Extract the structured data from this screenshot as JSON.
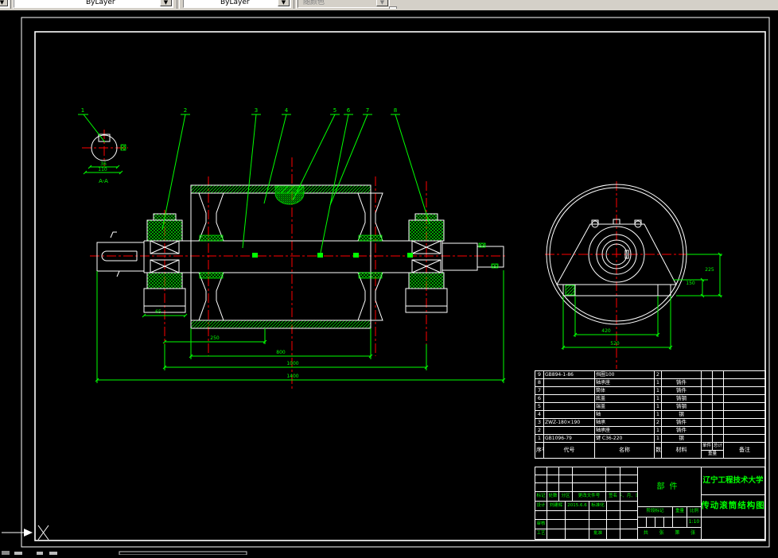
{
  "toolbar": {
    "linetype_value": "ByLayer",
    "lineweight_value": "ByLayer",
    "plotstyle_value": "随颜色"
  },
  "canvas": {
    "ucs_label": "X"
  },
  "detail_view": {
    "balloon": "1",
    "label": "A-A",
    "dim_width": "36",
    "dim_outer": "110"
  },
  "main_view": {
    "balloons": [
      "2",
      "3",
      "4",
      "5",
      "6",
      "7",
      "8"
    ],
    "dim_bearing": "65",
    "dim_hub": "250",
    "dim_shell": "800",
    "dim_span": "1000",
    "dim_total": "1400"
  },
  "side_view": {
    "dim_height": "225",
    "dim_base_height": "150",
    "dim_bolt_span": "420",
    "dim_base": "520"
  },
  "bom": {
    "headers": {
      "no": "序号",
      "code": "代号",
      "name": "名称",
      "qty": "数量",
      "material": "材料",
      "unit": "单件",
      "total": "总计",
      "weight": "重量",
      "remark": "备注"
    },
    "rows": [
      {
        "no": "9",
        "code": "GB894-1-86",
        "name": "挡圈100",
        "qty": "2",
        "material": ""
      },
      {
        "no": "8",
        "code": "",
        "name": "轴承座",
        "qty": "1",
        "material": "铸件"
      },
      {
        "no": "7",
        "code": "",
        "name": "筒体",
        "qty": "1",
        "material": "铸件"
      },
      {
        "no": "6",
        "code": "",
        "name": "底盖",
        "qty": "1",
        "material": "铸钢"
      },
      {
        "no": "5",
        "code": "",
        "name": "端盖",
        "qty": "1",
        "material": "铸钢"
      },
      {
        "no": "4",
        "code": "",
        "name": "轴",
        "qty": "1",
        "material": "钢"
      },
      {
        "no": "3",
        "code": "ZWZ-180×190",
        "name": "轴承",
        "qty": "2",
        "material": "铸件"
      },
      {
        "no": "2",
        "code": "",
        "name": "轴承座",
        "qty": "1",
        "material": "铸件"
      },
      {
        "no": "1",
        "code": "GB1096-79",
        "name": "键 C36-220",
        "qty": "1",
        "material": "钢"
      }
    ]
  },
  "titleblock": {
    "university": "辽宁工程技术大学",
    "drawing_title": "传动滚筒结构图",
    "part_type": "部件",
    "designer": "刘建辉",
    "design_date": "2015.6.6",
    "scale_value": "1:10",
    "labels": {
      "mark": "标记",
      "count": "处数",
      "zone": "分区",
      "change_no": "更改文件号",
      "sign": "签名",
      "date": "年、月、日",
      "design": "设计",
      "std": "标准化",
      "check": "审核",
      "process": "工艺",
      "approve": "批准",
      "stage": "阶段标记",
      "weight": "重量",
      "scale": "比例",
      "sheets_total": "共",
      "sheet_a": "张",
      "sheet_no": "第",
      "sheet_b": "张"
    }
  }
}
